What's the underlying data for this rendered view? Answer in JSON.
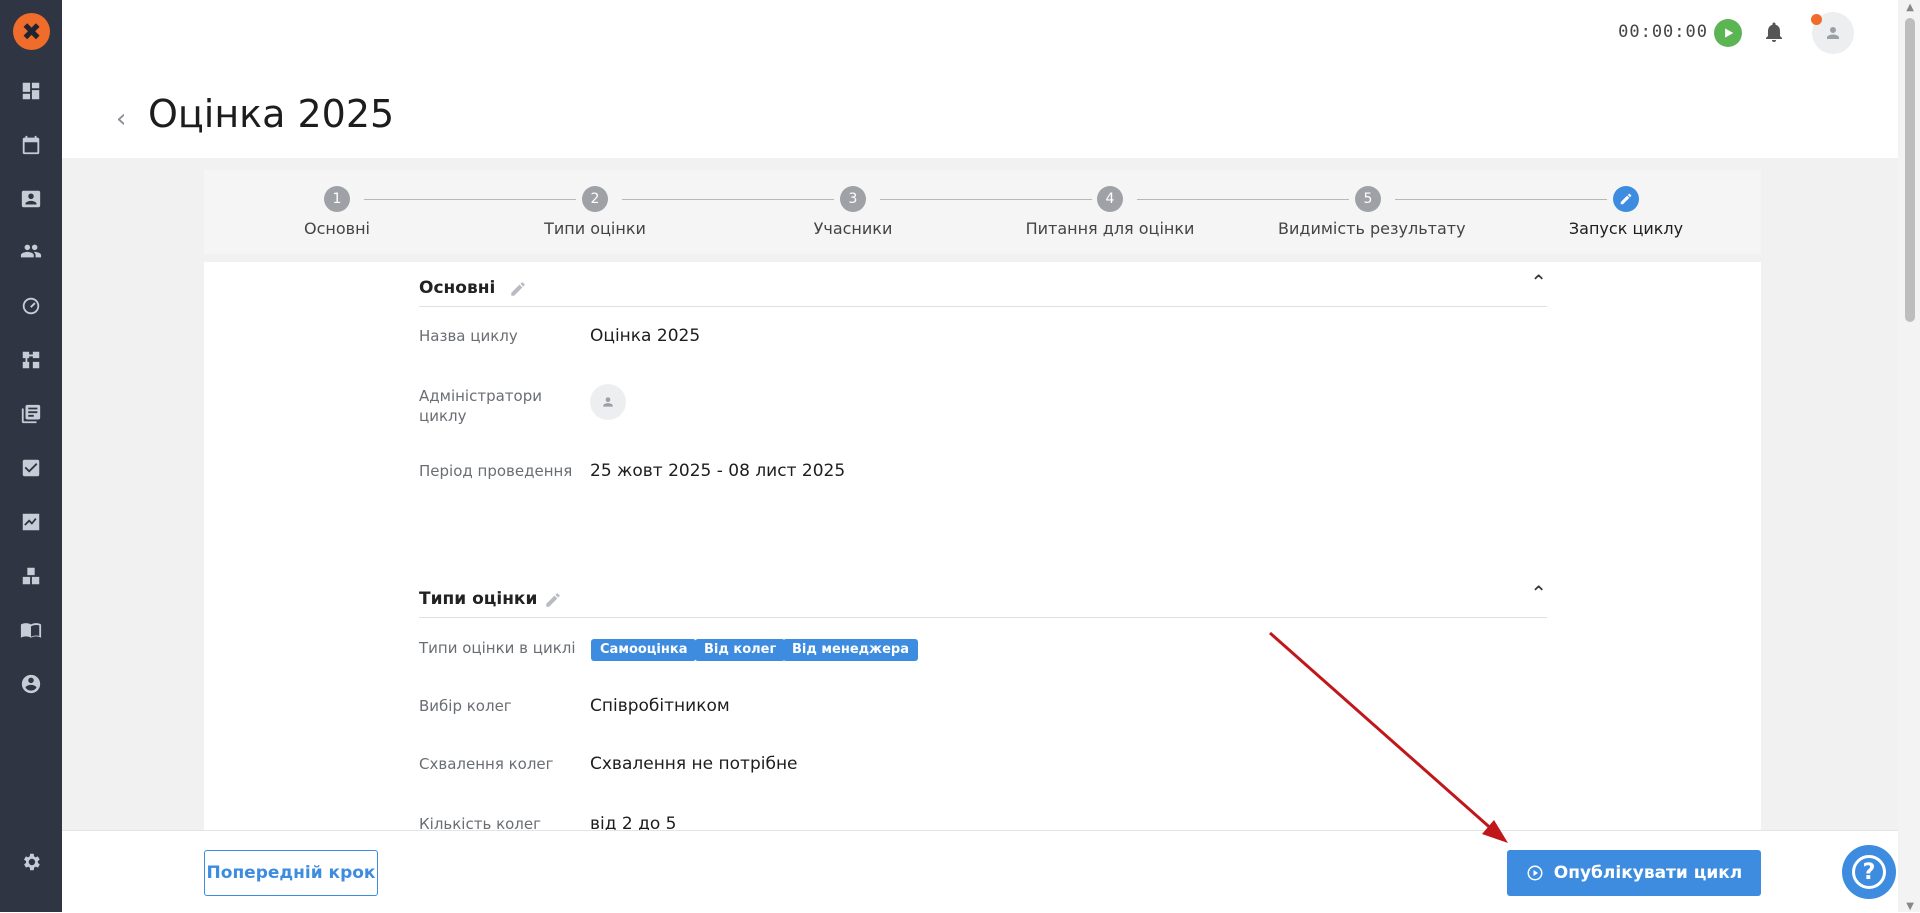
{
  "header": {
    "timer": "00:00:00",
    "page_title": "Оцінка 2025"
  },
  "stepper": {
    "steps": [
      {
        "number": "1",
        "label": "Основні"
      },
      {
        "number": "2",
        "label": "Типи оцінки"
      },
      {
        "number": "3",
        "label": "Учасники"
      },
      {
        "number": "4",
        "label": "Питання для оцінки"
      },
      {
        "number": "5",
        "label": "Видимість результату"
      },
      {
        "number": "",
        "label": "Запуск циклу",
        "active": true
      }
    ]
  },
  "sections": {
    "basics": {
      "title": "Основні",
      "cycle_name_label": "Назва циклу",
      "cycle_name_value": "Оцінка 2025",
      "admins_label_line1": "Адміністратори",
      "admins_label_line2": "циклу",
      "period_label": "Період проведення",
      "period_value": "25 жовт 2025 - 08 лист 2025"
    },
    "types": {
      "title": "Типи оцінки",
      "types_label": "Типи оцінки в циклі",
      "tags": [
        "Самооцінка",
        "Від колег",
        "Від менеджера"
      ],
      "colleague_choice_label": "Вибір колег",
      "colleague_choice_value": "Співробітником",
      "colleague_approval_label": "Схвалення колег",
      "colleague_approval_value": "Схвалення не потрібне",
      "colleague_count_label": "Кількість колег",
      "colleague_count_value": "від 2 до 5"
    }
  },
  "footer": {
    "prev_label": "Попередній крок",
    "publish_label": "Опублікувати цикл",
    "help_label": "?"
  },
  "colors": {
    "accent": "#3d8ce0",
    "sidebar": "#2f3542",
    "logo": "#ef6c2a",
    "play": "#5ab552",
    "annotation_arrow": "#c0171b"
  },
  "icons": {
    "sidebar": [
      "dashboard-icon",
      "calendar-icon",
      "contact-card-icon",
      "people-icon",
      "speedometer-icon",
      "org-chart-icon",
      "library-icon",
      "checklist-icon",
      "trending-chart-icon",
      "boxes-icon",
      "book-icon",
      "account-circle-icon",
      "settings-icon"
    ]
  }
}
